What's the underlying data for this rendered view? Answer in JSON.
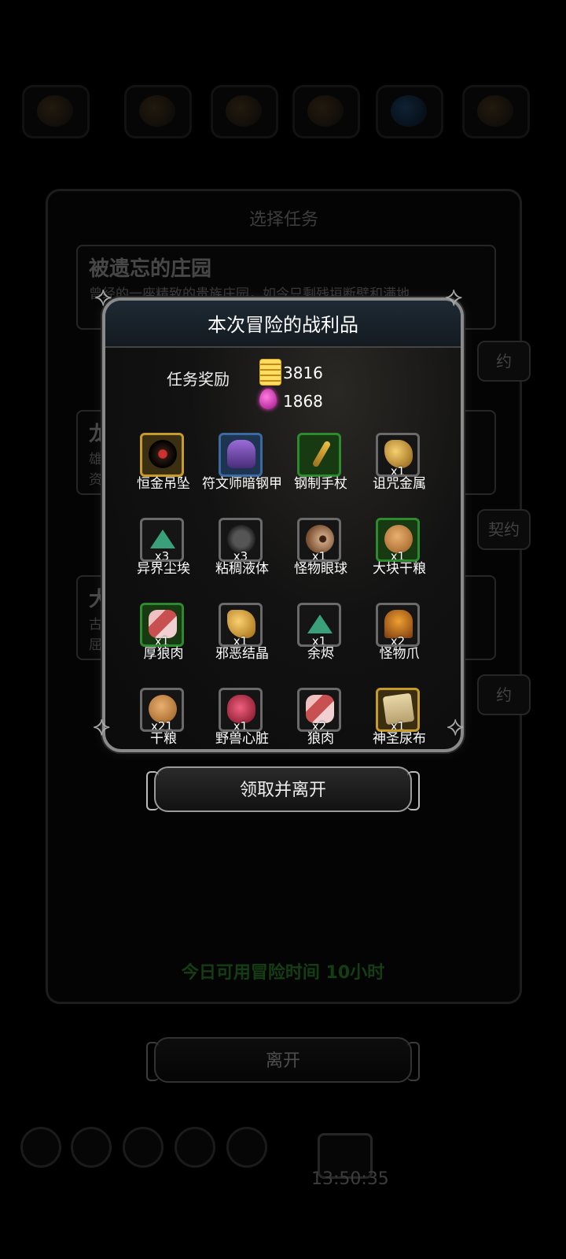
{
  "background": {
    "panel_title": "选择任务",
    "cards": [
      {
        "title": "被遗忘的庄园",
        "line1": "曾经的一座精致的贵族庄园，如今只剩残垣断壁和满地",
        "line2": "",
        "pact": "约"
      },
      {
        "title": "龙",
        "line1": "雄",
        "line2": "资",
        "pact": "契约"
      },
      {
        "title": "大",
        "line1": "古",
        "line2": "屈",
        "pact": "约"
      }
    ],
    "available_time": "今日可用冒险时间 10小时",
    "leave_label": "离开",
    "clock": "13:50:35"
  },
  "dialog": {
    "title": "本次冒险的战利品",
    "reward_label": "任务奖励",
    "gold": "3816",
    "gems": "1868",
    "items": [
      {
        "name": "恒金吊坠",
        "qty": "",
        "frame": "gold",
        "icon": "pendant-icon"
      },
      {
        "name": "符文师暗钢甲",
        "qty": "",
        "frame": "blue",
        "icon": "armor-icon"
      },
      {
        "name": "钢制手杖",
        "qty": "",
        "frame": "green",
        "icon": "staff-icon"
      },
      {
        "name": "诅咒金属",
        "qty": "x1",
        "frame": "gray",
        "icon": "cursed-metal-icon"
      },
      {
        "name": "异界尘埃",
        "qty": "x3",
        "frame": "gray",
        "icon": "dust-icon"
      },
      {
        "name": "粘稠液体",
        "qty": "x3",
        "frame": "gray",
        "icon": "liquid-icon"
      },
      {
        "name": "怪物眼球",
        "qty": "x1",
        "frame": "gray",
        "icon": "eyeball-icon"
      },
      {
        "name": "大块干粮",
        "qty": "x1",
        "frame": "green",
        "icon": "bread-icon"
      },
      {
        "name": "厚狼肉",
        "qty": "x1",
        "frame": "green",
        "icon": "meat-icon"
      },
      {
        "name": "邪恶结晶",
        "qty": "x1",
        "frame": "gray",
        "icon": "crystal-icon"
      },
      {
        "name": "余烬",
        "qty": "x1",
        "frame": "gray",
        "icon": "ember-icon"
      },
      {
        "name": "怪物爪",
        "qty": "x2",
        "frame": "gray",
        "icon": "claw-icon"
      },
      {
        "name": "干粮",
        "qty": "x21",
        "frame": "gray",
        "icon": "bread-icon"
      },
      {
        "name": "野兽心脏",
        "qty": "x1",
        "frame": "gray",
        "icon": "heart-icon"
      },
      {
        "name": "狼肉",
        "qty": "x2",
        "frame": "gray",
        "icon": "meat-icon"
      },
      {
        "name": "神圣尿布",
        "qty": "x1",
        "frame": "gold",
        "icon": "scroll-icon"
      }
    ]
  },
  "claim_label": "领取并离开"
}
